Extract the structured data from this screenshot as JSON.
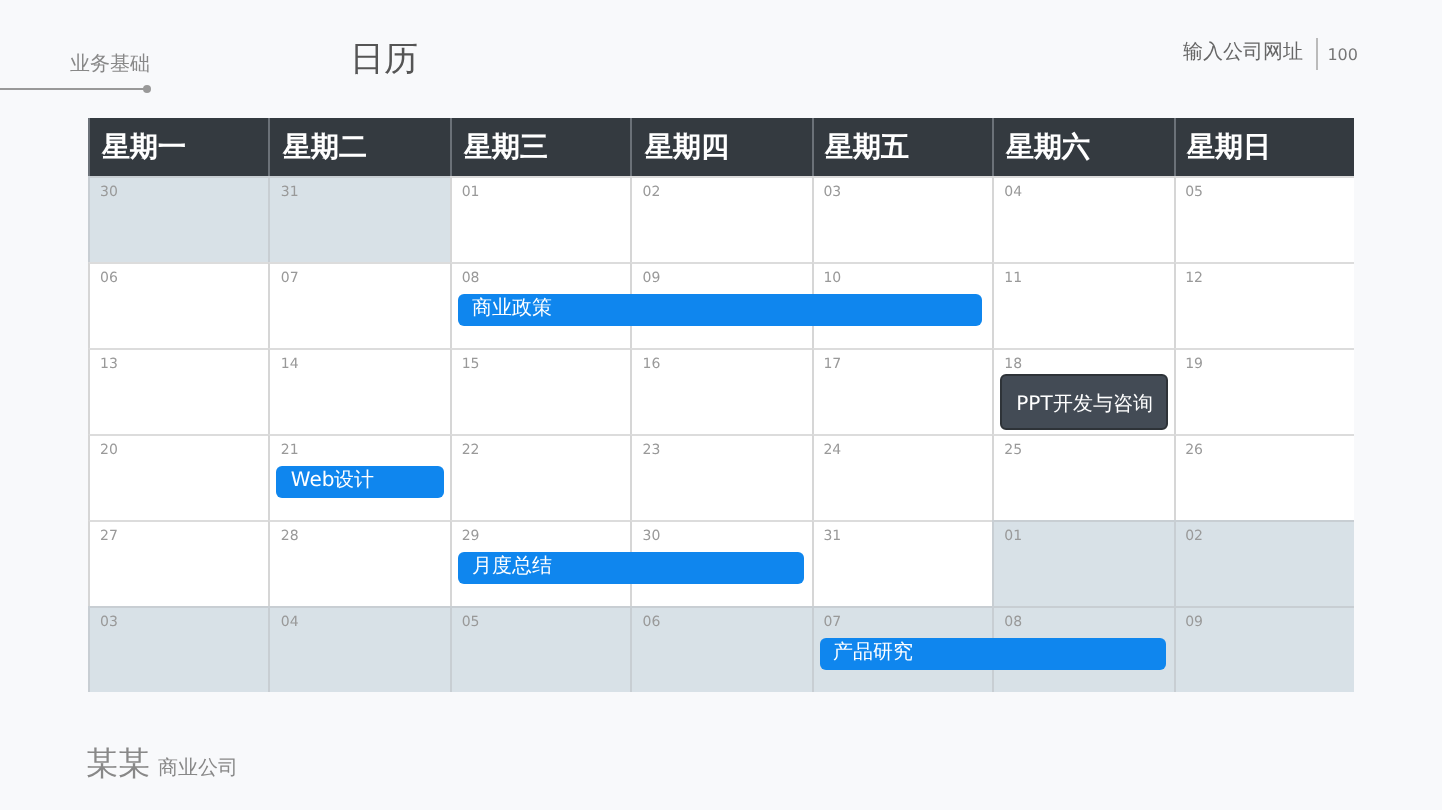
{
  "header": {
    "section": "业务基础",
    "title": "日历",
    "website": "输入公司网址",
    "page_number": "100"
  },
  "calendar": {
    "weekdays": [
      "星期一",
      "星期二",
      "星期三",
      "星期四",
      "星期五",
      "星期六",
      "星期日"
    ],
    "weeks": [
      {
        "days": [
          {
            "day": "30",
            "outside": true
          },
          {
            "day": "31",
            "outside": true
          },
          {
            "day": "01",
            "outside": false
          },
          {
            "day": "02",
            "outside": false
          },
          {
            "day": "03",
            "outside": false
          },
          {
            "day": "04",
            "outside": false
          },
          {
            "day": "05",
            "outside": false
          }
        ]
      },
      {
        "days": [
          {
            "day": "06",
            "outside": false
          },
          {
            "day": "07",
            "outside": false
          },
          {
            "day": "08",
            "outside": false,
            "event": {
              "title": "商业政策",
              "kind": "primary"
            }
          },
          {
            "day": "09",
            "outside": false,
            "continues": true
          },
          {
            "day": "10",
            "outside": false,
            "continues": true
          },
          {
            "day": "11",
            "outside": false
          },
          {
            "day": "12",
            "outside": false
          }
        ]
      },
      {
        "days": [
          {
            "day": "13",
            "outside": false
          },
          {
            "day": "14",
            "outside": false
          },
          {
            "day": "15",
            "outside": false
          },
          {
            "day": "16",
            "outside": false
          },
          {
            "day": "17",
            "outside": false
          },
          {
            "day": "18",
            "outside": false,
            "event": {
              "title": "PPT开发与咨询",
              "kind": "dark"
            }
          },
          {
            "day": "19",
            "outside": false
          }
        ]
      },
      {
        "days": [
          {
            "day": "20",
            "outside": false
          },
          {
            "day": "21",
            "outside": false,
            "event": {
              "title": "Web设计",
              "kind": "primary"
            }
          },
          {
            "day": "22",
            "outside": false
          },
          {
            "day": "23",
            "outside": false
          },
          {
            "day": "24",
            "outside": false
          },
          {
            "day": "25",
            "outside": false
          },
          {
            "day": "26",
            "outside": false
          }
        ]
      },
      {
        "days": [
          {
            "day": "27",
            "outside": false
          },
          {
            "day": "28",
            "outside": false
          },
          {
            "day": "29",
            "outside": false,
            "event": {
              "title": "月度总结",
              "kind": "primary"
            }
          },
          {
            "day": "30",
            "outside": false,
            "continues": true
          },
          {
            "day": "31",
            "outside": false
          },
          {
            "day": "01",
            "outside": true
          },
          {
            "day": "02",
            "outside": true
          }
        ]
      },
      {
        "days": [
          {
            "day": "03",
            "outside": true
          },
          {
            "day": "04",
            "outside": true
          },
          {
            "day": "05",
            "outside": true
          },
          {
            "day": "06",
            "outside": true
          },
          {
            "day": "07",
            "outside": true,
            "event": {
              "title": "产品研究",
              "kind": "primary"
            }
          },
          {
            "day": "08",
            "outside": true,
            "continues": true
          },
          {
            "day": "09",
            "outside": true
          }
        ]
      }
    ]
  },
  "footer": {
    "company": "某某",
    "subtitle": "商业公司"
  }
}
